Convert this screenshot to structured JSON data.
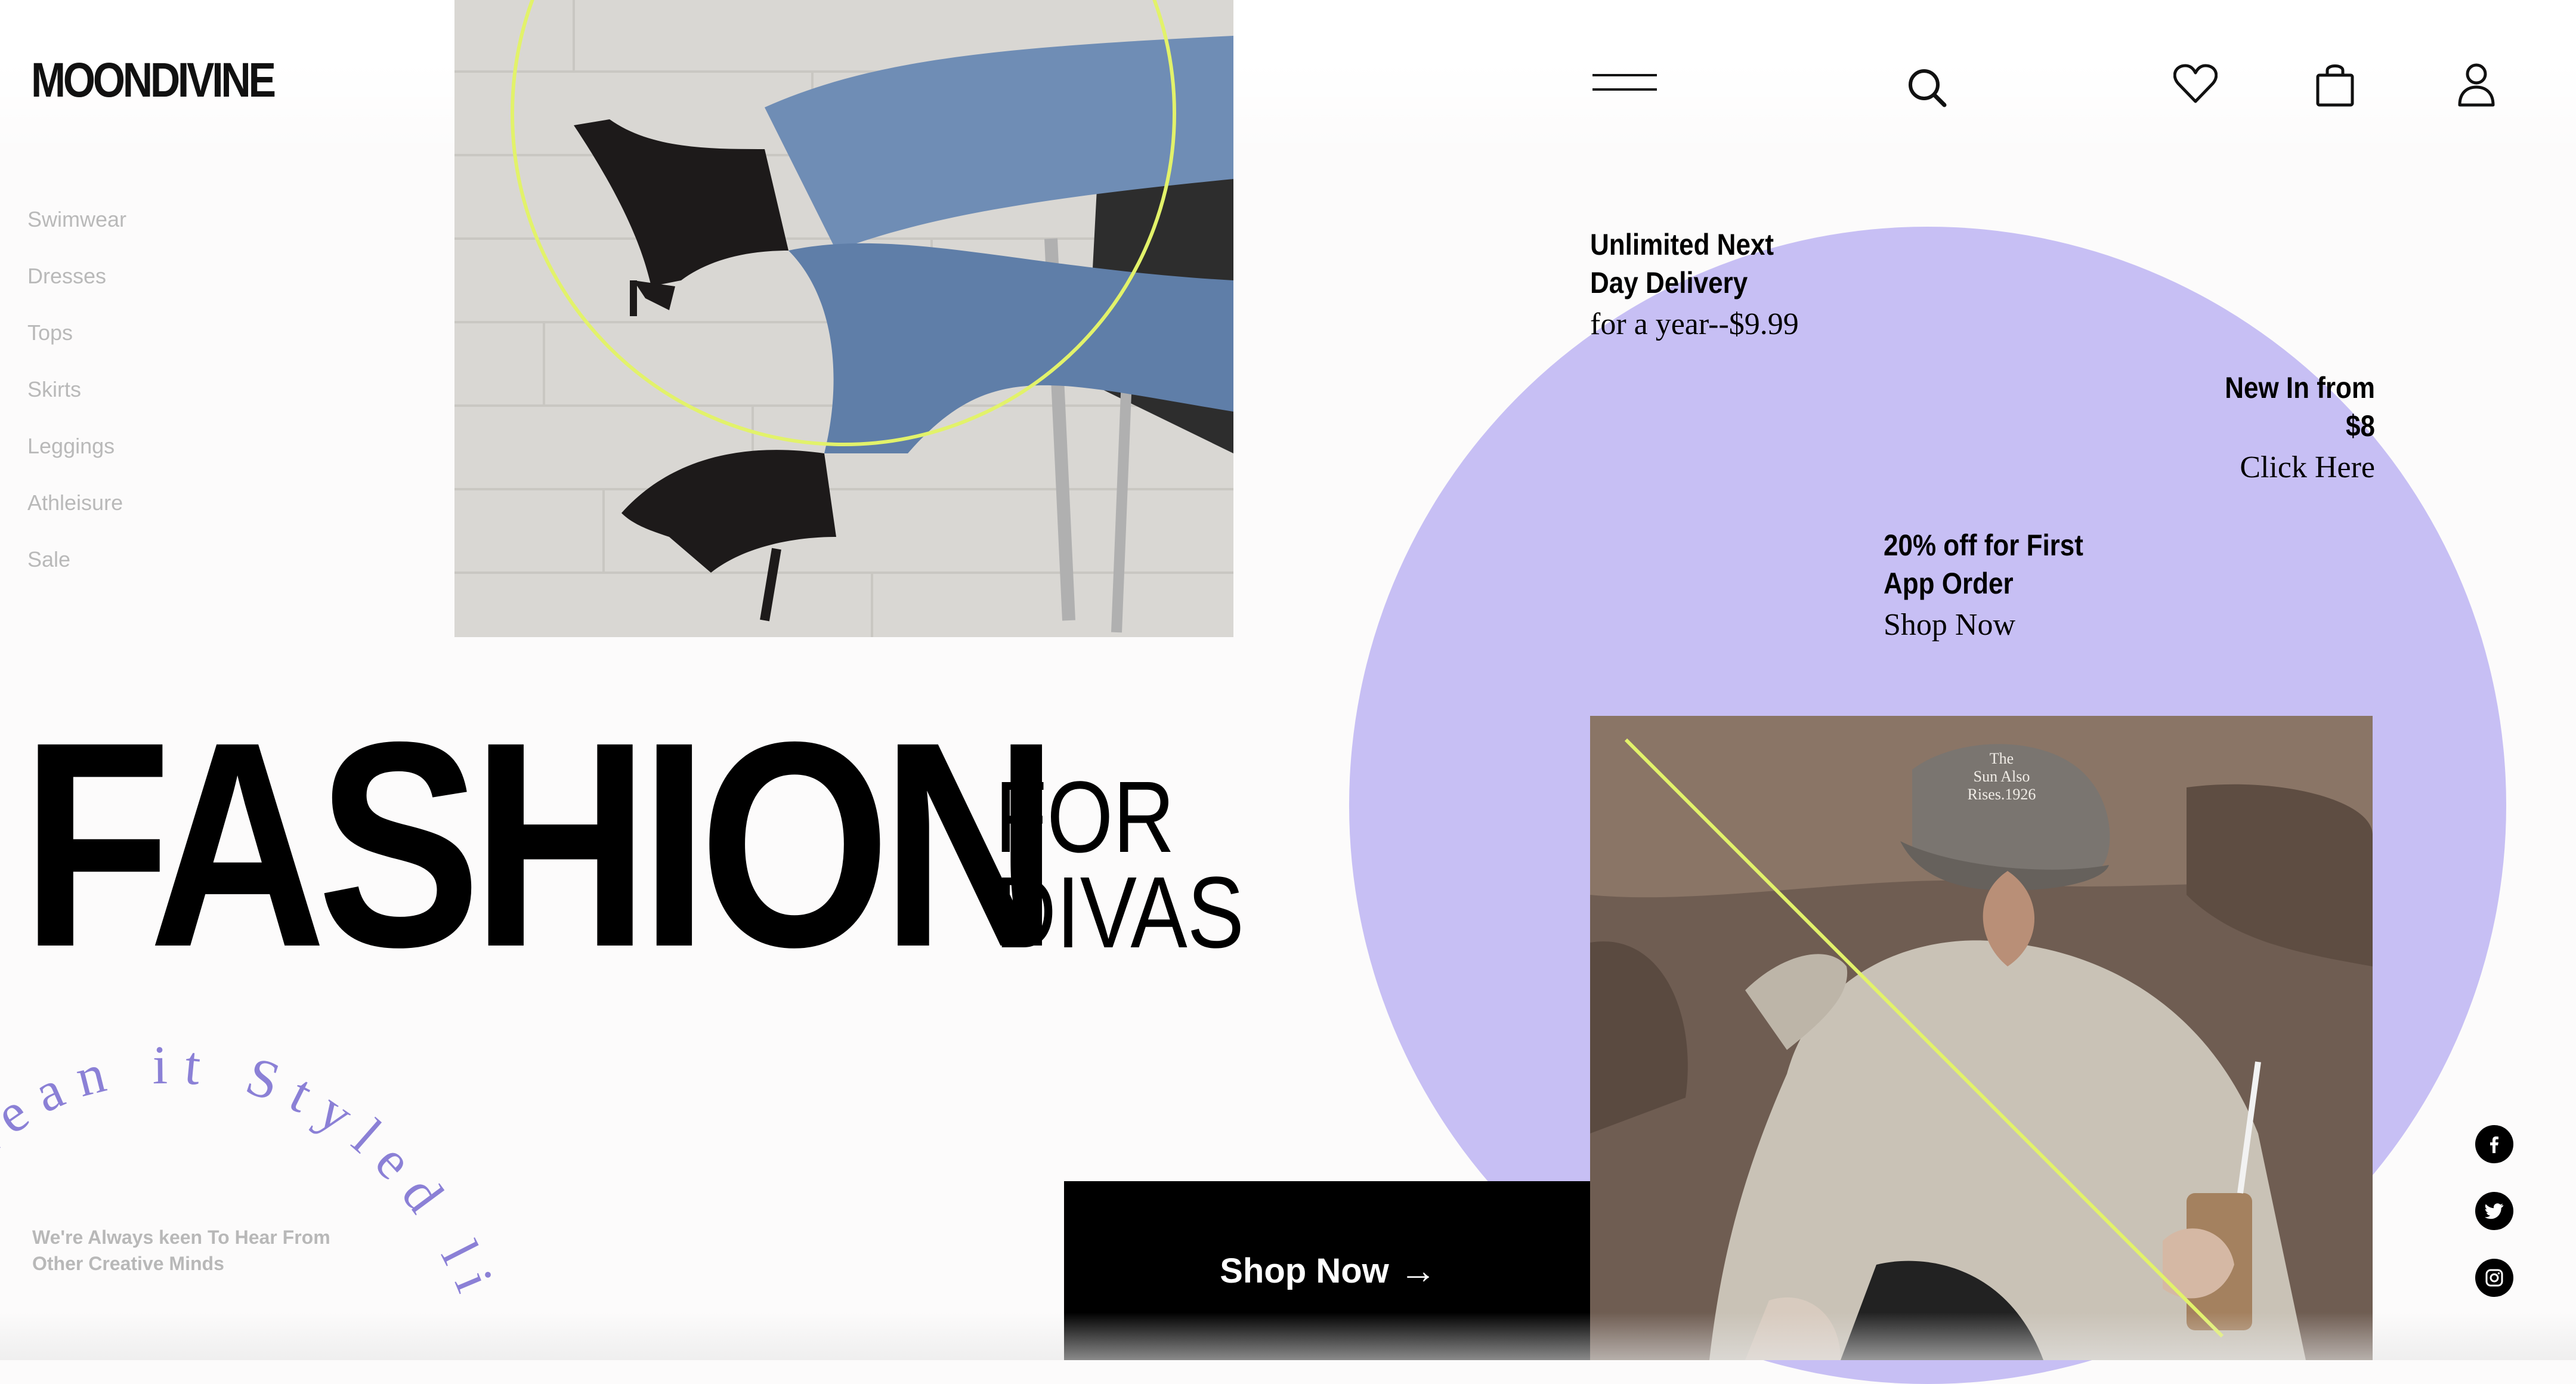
{
  "brand": {
    "logo_text": "MOONDIVINE"
  },
  "sidebar": {
    "items": [
      {
        "label": "Swimwear"
      },
      {
        "label": "Dresses"
      },
      {
        "label": "Tops"
      },
      {
        "label": "Skirts"
      },
      {
        "label": "Leggings"
      },
      {
        "label": "Athleisure"
      },
      {
        "label": "Sale"
      }
    ]
  },
  "header": {
    "icons": [
      "menu-icon",
      "search-icon",
      "heart-icon",
      "shopping-bag-icon",
      "user-icon"
    ]
  },
  "hero": {
    "title_main": "FASHION",
    "title_line1": "FOR",
    "title_line2": "DIVAS",
    "curved_text": "mean it Styled li",
    "cta_label": "Shop Now",
    "cta_arrow": "→"
  },
  "promos": {
    "delivery": {
      "line1": "Unlimited Next",
      "line2": "Day Delivery",
      "sub": "for a year--$9.99"
    },
    "new_in": {
      "title": "New In from $8",
      "link": "Click Here"
    },
    "app_order": {
      "line1": "20% off for First",
      "line2": "App Order",
      "link": "Shop Now"
    }
  },
  "footer_note": {
    "line1": "We're Always keen To Hear From",
    "line2": "Other Creative Minds"
  },
  "social": [
    "facebook-icon",
    "twitter-icon",
    "instagram-icon"
  ],
  "colors": {
    "accent_purple": "#c7bff4",
    "accent_lime": "#e2f26a",
    "text_muted": "#b9b9b9",
    "black": "#000000"
  }
}
